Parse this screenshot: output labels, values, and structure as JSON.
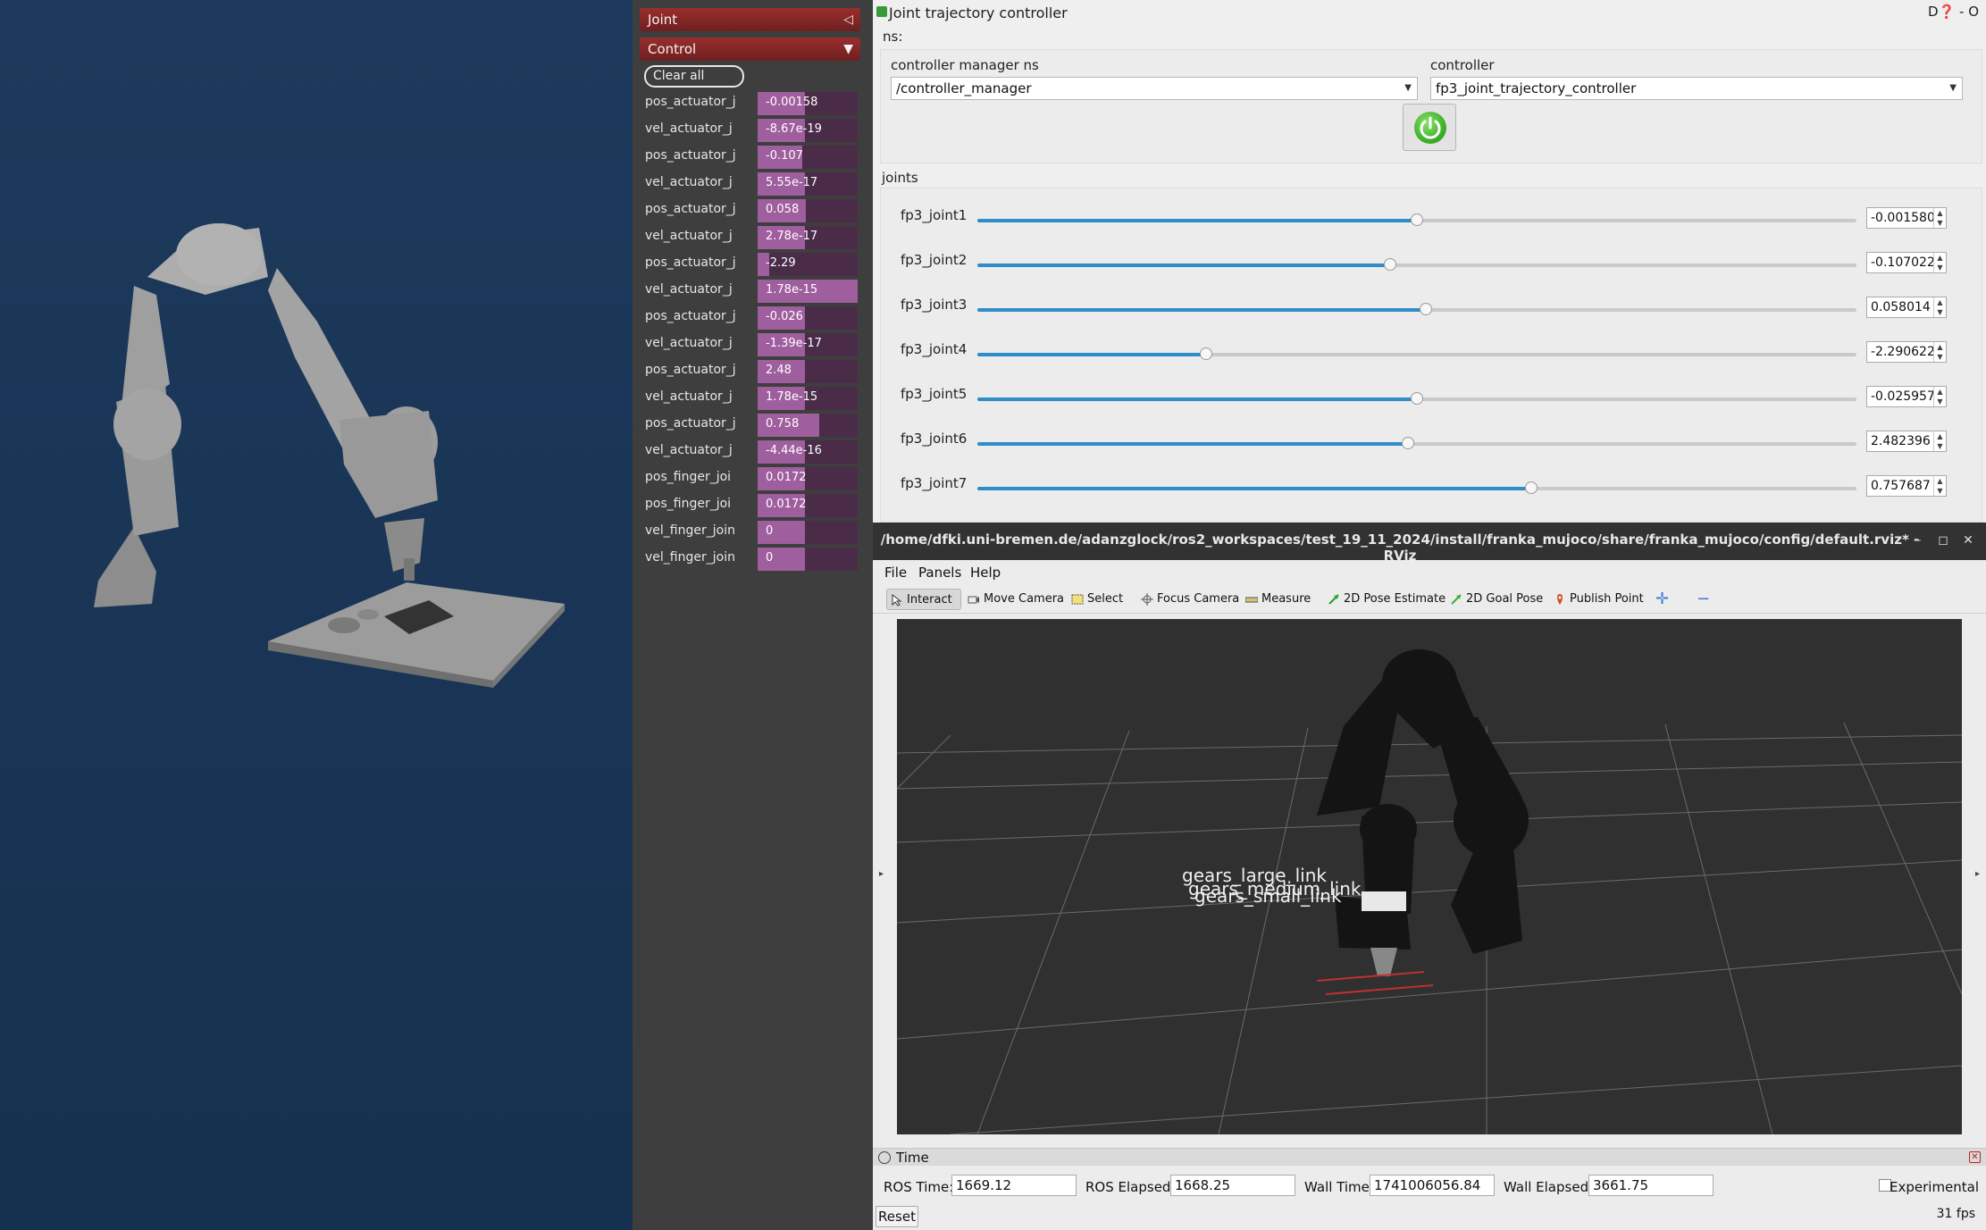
{
  "mujoco": {
    "joint_section": "Joint",
    "joint_arrow": "◁",
    "control_section": "Control",
    "control_arrow": "▼",
    "clear_all": "Clear all",
    "rows": [
      {
        "label": "pos_actuator_j",
        "value": "-0.00158",
        "level": 0.47
      },
      {
        "label": "vel_actuator_j",
        "value": "-8.67e-19",
        "level": 0.47
      },
      {
        "label": "pos_actuator_j",
        "value": "-0.107",
        "level": 0.45
      },
      {
        "label": "vel_actuator_j",
        "value": "5.55e-17",
        "level": 0.47
      },
      {
        "label": "pos_actuator_j",
        "value": "0.058",
        "level": 0.48
      },
      {
        "label": "vel_actuator_j",
        "value": "2.78e-17",
        "level": 0.47
      },
      {
        "label": "pos_actuator_j",
        "value": "-2.29",
        "level": 0.12
      },
      {
        "label": "vel_actuator_j",
        "value": "1.78e-15",
        "level": 1.0
      },
      {
        "label": "pos_actuator_j",
        "value": "-0.026",
        "level": 0.47
      },
      {
        "label": "vel_actuator_j",
        "value": "-1.39e-17",
        "level": 0.47
      },
      {
        "label": "pos_actuator_j",
        "value": "2.48",
        "level": 0.47
      },
      {
        "label": "vel_actuator_j",
        "value": "1.78e-15",
        "level": 0.47
      },
      {
        "label": "pos_actuator_j",
        "value": "0.758",
        "level": 0.62
      },
      {
        "label": "vel_actuator_j",
        "value": "-4.44e-16",
        "level": 0.47
      },
      {
        "label": "pos_finger_joi",
        "value": "0.0172",
        "level": 0.47
      },
      {
        "label": "pos_finger_joi",
        "value": "0.0172",
        "level": 0.47
      },
      {
        "label": "vel_finger_join",
        "value": "0",
        "level": 0.47
      },
      {
        "label": "vel_finger_join",
        "value": "0",
        "level": 0.47
      }
    ]
  },
  "jtc": {
    "title": "Joint trajectory controller",
    "corner": "D❓ - O",
    "ns_label": "ns:",
    "cm_label": "controller manager ns",
    "cm_value": "/controller_manager",
    "controller_label": "controller",
    "controller_value": "fp3_joint_trajectory_controller",
    "joints_label": "joints",
    "joints": [
      {
        "name": "fp3_joint1",
        "value": "-0.001580",
        "level": 0.5
      },
      {
        "name": "fp3_joint2",
        "value": "-0.107022",
        "level": 0.47
      },
      {
        "name": "fp3_joint3",
        "value": "0.058014",
        "level": 0.51
      },
      {
        "name": "fp3_joint4",
        "value": "-2.290622",
        "level": 0.26
      },
      {
        "name": "fp3_joint5",
        "value": "-0.025957",
        "level": 0.5
      },
      {
        "name": "fp3_joint6",
        "value": "2.482396",
        "level": 0.49
      },
      {
        "name": "fp3_joint7",
        "value": "0.757687",
        "level": 0.63
      }
    ]
  },
  "rviz": {
    "title": "/home/dfki.uni-bremen.de/adanzglock/ros2_workspaces/test_19_11_2024/install/franka_mujoco/share/franka_mujoco/config/default.rviz* - RViz",
    "menus": [
      "File",
      "Panels",
      "Help"
    ],
    "tools": [
      "Interact",
      "Move Camera",
      "Select",
      "Focus Camera",
      "Measure",
      "2D Pose Estimate",
      "2D Goal Pose",
      "Publish Point"
    ],
    "tf_labels": [
      "gears_large_link",
      "gears_medium_link",
      "gears_small_link"
    ],
    "time_panel": {
      "title": "Time",
      "ros_time_label": "ROS Time:",
      "ros_time": "1669.12",
      "ros_elapsed_label": "ROS Elapsed:",
      "ros_elapsed": "1668.25",
      "wall_time_label": "Wall Time:",
      "wall_time": "1741006056.84",
      "wall_elapsed_label": "Wall Elapsed:",
      "wall_elapsed": "3661.75",
      "experimental_label": "Experimental",
      "reset_label": "Reset",
      "fps": "31 fps"
    }
  },
  "colors": {
    "mujoco_bar": "#9f5e9e",
    "slider_fill": "#308cc6",
    "power_green": "#3fb22a"
  }
}
